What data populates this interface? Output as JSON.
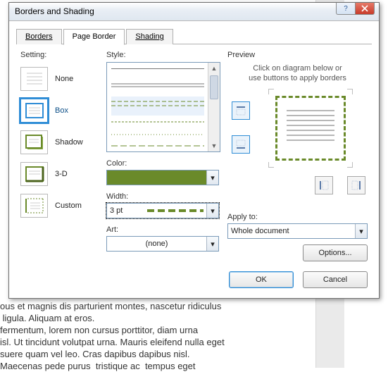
{
  "dialog": {
    "title": "Borders and Shading",
    "tabs": {
      "borders": "Borders",
      "page_border": "Page Border",
      "shading": "Shading"
    },
    "setting": {
      "label": "Setting:",
      "items": [
        {
          "label": "None"
        },
        {
          "label": "Box"
        },
        {
          "label": "Shadow"
        },
        {
          "label": "3-D"
        },
        {
          "label": "Custom"
        }
      ],
      "selected": 1
    },
    "style": {
      "label": "Style:"
    },
    "color": {
      "label": "Color:",
      "value_hex": "#6a8a2a"
    },
    "width": {
      "label": "Width:",
      "value": "3 pt"
    },
    "art": {
      "label": "Art:",
      "value": "(none)"
    },
    "preview": {
      "label": "Preview",
      "hint_line1": "Click on diagram below or",
      "hint_line2": "use buttons to apply borders"
    },
    "apply_to": {
      "label": "Apply to:",
      "value": "Whole document"
    },
    "options_btn": "Options...",
    "ok": "OK",
    "cancel": "Cancel"
  },
  "background_doc_text": "ous et magnis dis parturient montes, nascetur ridiculus\n ligula. Aliquam at eros.\nfermentum, lorem non cursus porttitor, diam urna\nisl. Ut tincidunt volutpat urna. Mauris eleifend nulla eget\nsuere quam vel leo. Cras dapibus dapibus nisl.\nMaecenas pede purus  tristique ac  tempus eget"
}
